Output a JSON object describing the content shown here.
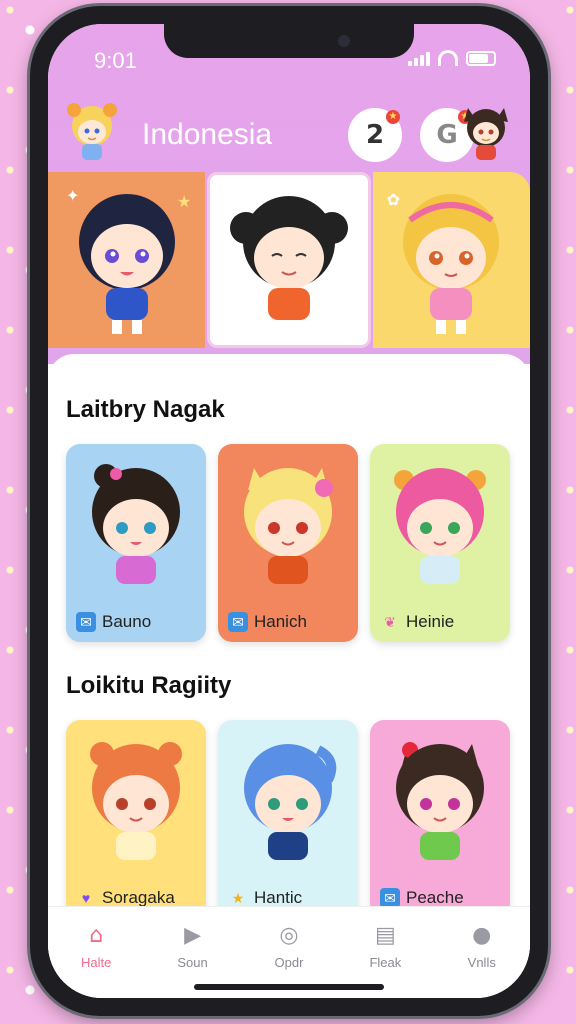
{
  "status": {
    "time": "9:01"
  },
  "header": {
    "title": "Indonesia",
    "badge1_label": "2",
    "badge2_label": "G"
  },
  "sections": [
    {
      "title": "Laitbry Nagak",
      "cards": [
        {
          "name": "Bauno",
          "bg": "#a9d3f3",
          "icon": "envelope-heart-icon",
          "icon_char": "✉"
        },
        {
          "name": "Hanich",
          "bg": "#f2875e",
          "icon": "envelope-heart-icon",
          "icon_char": "✉"
        },
        {
          "name": "Heinie",
          "bg": "#dff2a4",
          "icon": "bow-icon",
          "icon_char": "🎀"
        }
      ]
    },
    {
      "title": "Loikitu Ragiity",
      "cards": [
        {
          "name": "Soragaka",
          "bg": "#ffe07a",
          "icon": "heart-icon",
          "icon_char": "♥"
        },
        {
          "name": "Hantic",
          "bg": "#d8f3f7",
          "icon": "star-icon",
          "icon_char": "★"
        },
        {
          "name": "Peache",
          "bg": "#f7a9d8",
          "icon": "envelope-heart-icon",
          "icon_char": "✉"
        }
      ]
    }
  ],
  "nav": [
    {
      "label": "Halte",
      "icon": "home-icon",
      "active": true
    },
    {
      "label": "Soun",
      "icon": "play-icon",
      "active": false
    },
    {
      "label": "Opdr",
      "icon": "disc-icon",
      "active": false
    },
    {
      "label": "Fleak",
      "icon": "book-icon",
      "active": false
    },
    {
      "label": "Vnlls",
      "icon": "profile-icon",
      "active": false
    }
  ],
  "colors": {
    "header_bg": "#e7a4ea",
    "accent": "#f06a8b"
  }
}
